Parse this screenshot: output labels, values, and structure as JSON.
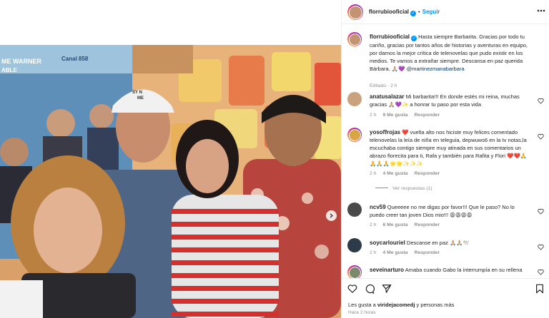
{
  "post": {
    "username": "florrubiooficial",
    "follow_label": "Seguir",
    "separator": "•",
    "more_icon": "more-horizontal-icon",
    "photo": {
      "sign_left": "ME WARNER",
      "sign_left2": "ABLE",
      "sign_channel": "Canal 858",
      "cap_text": "SY N\nME\nCASO"
    },
    "caption": {
      "username": "florrubiooficial",
      "text": "Hasta siempre Barbarita. Gracias por todo tu cariño, gracias por tantos años de historias y aventuras en equipo, por darnos la mejor crítica de telenovelas que pudo existir en los medios. Te vamos a extrañar siempre. Descansa en paz querida Bárbara. 🙏🏼💜 ",
      "mention": "@martinezmanabarbara",
      "meta": "Editado · 2 h"
    }
  },
  "comments": [
    {
      "username": "anatusalazar",
      "text": "Mi barbarita!!! En donde estés mi reina, muchas gracias 🙏🏼💜✨ a honrar tu paso por esta vida",
      "time": "2 h",
      "likes": "9 Me gusta",
      "reply": "Responder",
      "avatar_color": "#c9a27e"
    },
    {
      "username": "yosoffrojas",
      "text": "❤️ vuelta alto nos hiciste muy felices comentado telenovelas la leía de niña en teleguia, depwuws6 en la tv notas,la escuchaba contigo siempre muy atinada en sus comentarios un abrazo florecita para ti, Rafa y también para Rafita y Flori ❤️❤️🙏🙏🙏🙏🌟🌟✨✨✨",
      "time": "2 h",
      "likes": "4 Me gusta",
      "reply": "Responder",
      "view_replies": "Ver respuestas (1)",
      "avatar_color": "#d9a441"
    },
    {
      "username": "ncv59",
      "text": "Queeeee no me digas por favor!!! Que le paso? No lo puedo creer tan joven Dios mio!!! 😩😩😩😩",
      "time": "2 h",
      "likes": "6 Me gusta",
      "reply": "Responder",
      "avatar_color": "#4a4a4a"
    },
    {
      "username": "soycarlouriel",
      "text": "Descanse en paz 🙏🏼🙏🏼🕊️",
      "time": "2 h",
      "likes": "4 Me gusta",
      "reply": "Responder",
      "avatar_color": "#2d3a4a"
    },
    {
      "username": "seveinarturo",
      "text": "Amaba cuando Gabo la interrumpía en su rellena",
      "avatar_color": "#7a8a6a"
    }
  ],
  "actions": {
    "like_icon": "heart-icon",
    "comment_icon": "comment-icon",
    "share_icon": "send-icon",
    "save_icon": "bookmark-icon",
    "likes_prefix": "Les gusta a ",
    "likes_user": "viridejacomedj",
    "likes_suffix": " y personas más",
    "time_ago": "Hace 2 horas"
  }
}
